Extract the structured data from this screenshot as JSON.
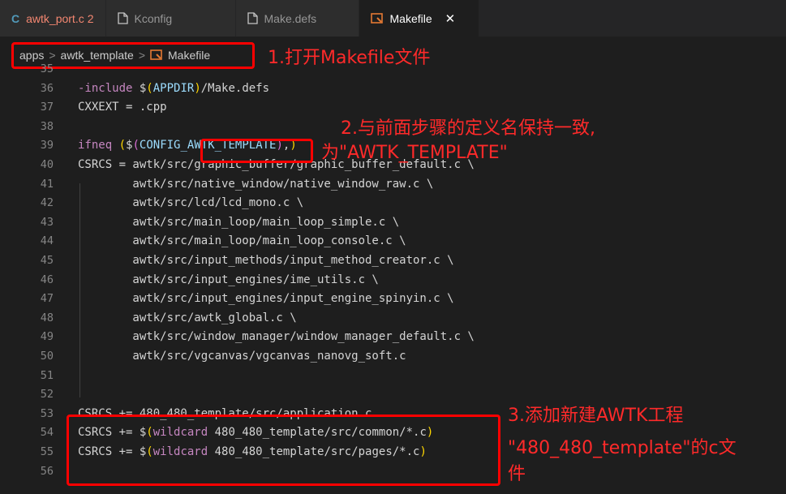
{
  "tabs": [
    {
      "label": "awtk_port.c",
      "badge": "2",
      "icon": "c-file-icon",
      "active": false
    },
    {
      "label": "Kconfig",
      "icon": "file-icon",
      "active": false
    },
    {
      "label": "Make.defs",
      "icon": "file-icon",
      "active": false
    },
    {
      "label": "Makefile",
      "icon": "makefile-icon",
      "active": true,
      "close": "✕"
    }
  ],
  "breadcrumb": {
    "items": [
      "apps",
      "awtk_template",
      "Makefile"
    ],
    "separator": ">"
  },
  "annotations": {
    "step1": "1.打开Makefile文件",
    "step2_line1": "2.与前面步骤的定义名保持一致,",
    "step2_line2": "为\"AWTK_TEMPLATE\"",
    "step3_line1": "3.添加新建AWTK工程",
    "step3_line2": "\"480_480_template\"的c文",
    "step3_line3": "件"
  },
  "code": {
    "lines": [
      {
        "n": "35",
        "t": ""
      },
      {
        "n": "36",
        "t": "-include $(APPDIR)/Make.defs"
      },
      {
        "n": "37",
        "t": "CXXEXT = .cpp"
      },
      {
        "n": "38",
        "t": ""
      },
      {
        "n": "39",
        "t": "ifneq ($(CONFIG_AWTK_TEMPLATE),)"
      },
      {
        "n": "40",
        "t": "CSRCS = awtk/src/graphic_buffer/graphic_buffer_default.c \\"
      },
      {
        "n": "41",
        "t": "        awtk/src/native_window/native_window_raw.c \\"
      },
      {
        "n": "42",
        "t": "        awtk/src/lcd/lcd_mono.c \\"
      },
      {
        "n": "43",
        "t": "        awtk/src/main_loop/main_loop_simple.c \\"
      },
      {
        "n": "44",
        "t": "        awtk/src/main_loop/main_loop_console.c \\"
      },
      {
        "n": "45",
        "t": "        awtk/src/input_methods/input_method_creator.c \\"
      },
      {
        "n": "46",
        "t": "        awtk/src/input_engines/ime_utils.c \\"
      },
      {
        "n": "47",
        "t": "        awtk/src/input_engines/input_engine_spinyin.c \\"
      },
      {
        "n": "48",
        "t": "        awtk/src/awtk_global.c \\"
      },
      {
        "n": "49",
        "t": "        awtk/src/window_manager/window_manager_default.c \\"
      },
      {
        "n": "50",
        "t": "        awtk/src/vgcanvas/vgcanvas_nanovg_soft.c"
      },
      {
        "n": "51",
        "t": ""
      },
      {
        "n": "52",
        "t": ""
      },
      {
        "n": "53",
        "t": "CSRCS += 480_480_template/src/application.c"
      },
      {
        "n": "54",
        "t": "CSRCS += $(wildcard 480_480_template/src/common/*.c)"
      },
      {
        "n": "55",
        "t": "CSRCS += $(wildcard 480_480_template/src/pages/*.c)"
      },
      {
        "n": "56",
        "t": ""
      }
    ]
  },
  "colors": {
    "background": "#1e1e1e",
    "annotation": "#ff2a2a",
    "keyword": "#c586c0",
    "variable": "#9cdcfe",
    "bracket": "#ffd700"
  }
}
